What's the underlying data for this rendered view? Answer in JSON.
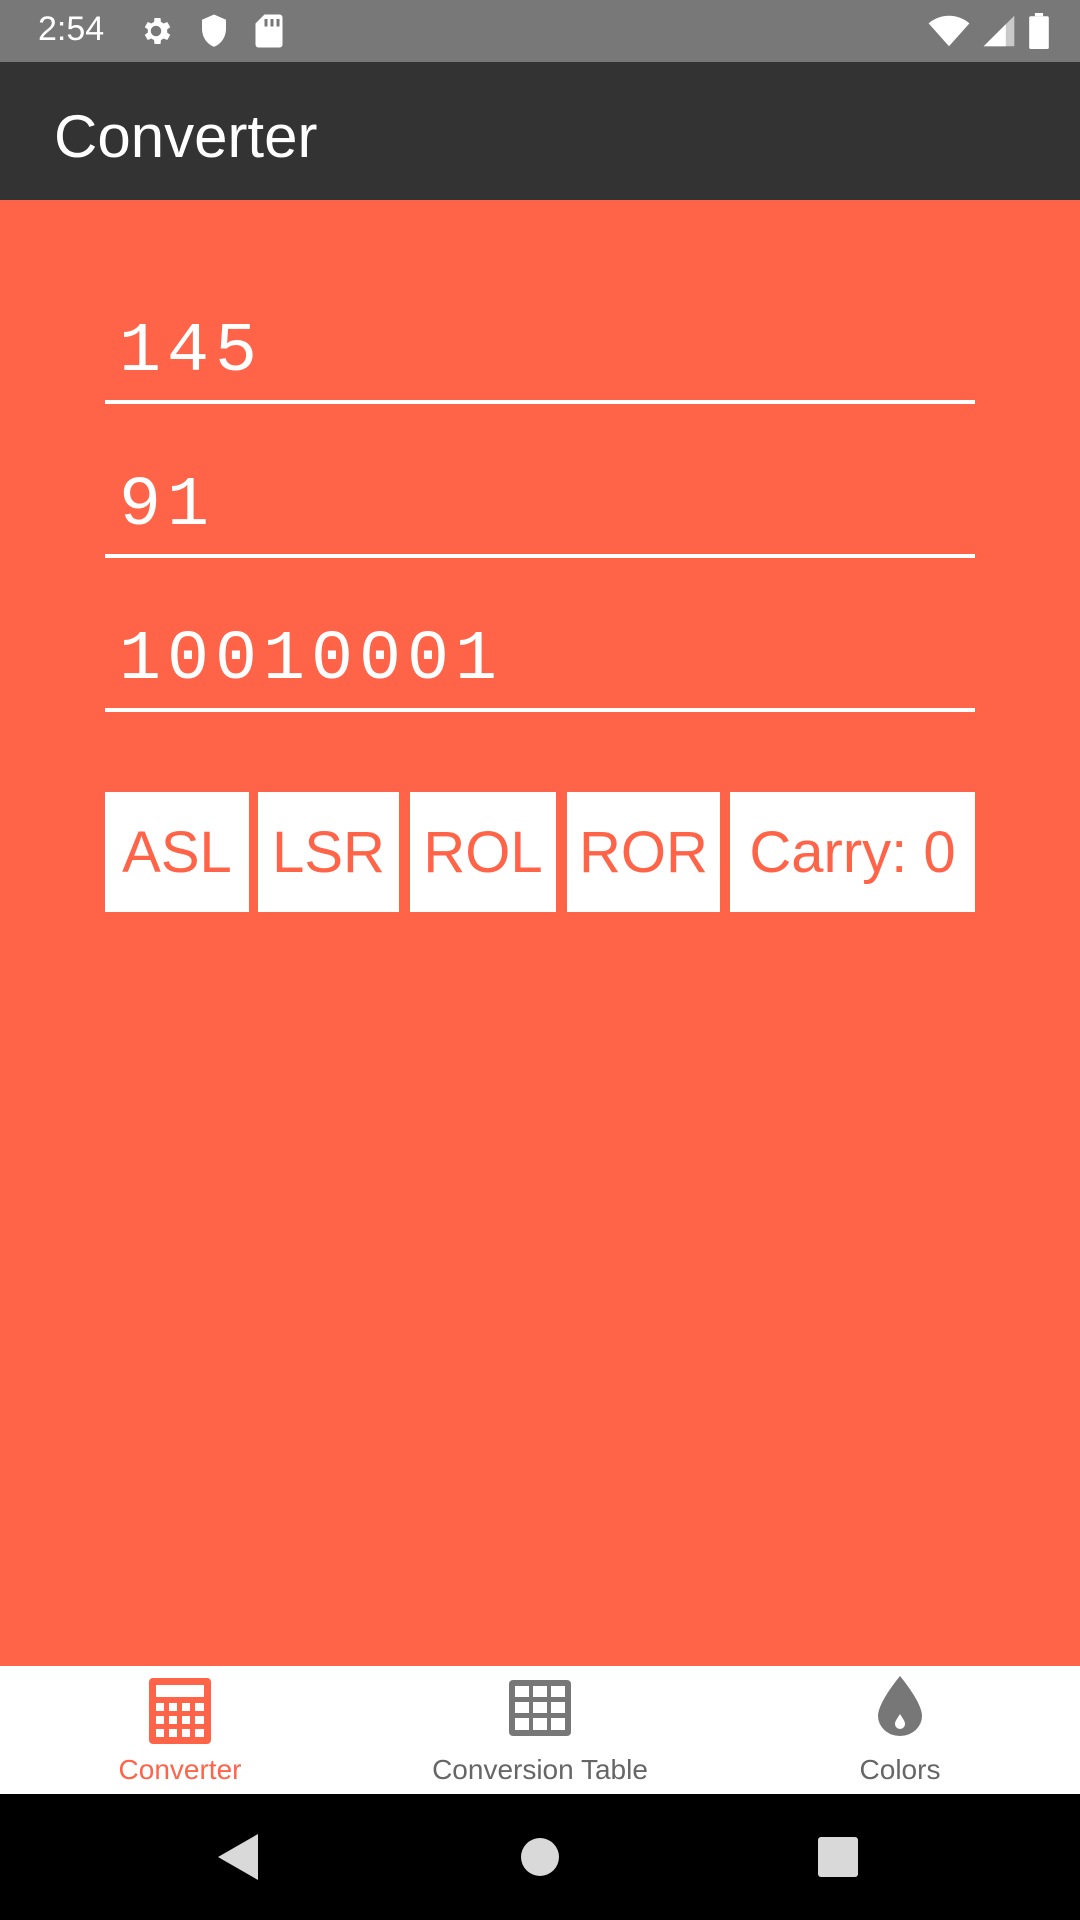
{
  "status_bar": {
    "time": "2:54",
    "icons_left": [
      "gear-icon",
      "shield-icon",
      "sd-card-icon"
    ],
    "icons_right": [
      "wifi-icon",
      "signal-icon",
      "battery-icon"
    ]
  },
  "app_bar": {
    "title": "Converter"
  },
  "fields": {
    "decimal": "145",
    "hex": "91",
    "binary": "10010001"
  },
  "buttons": {
    "asl": "ASL",
    "lsr": "LSR",
    "rol": "ROL",
    "ror": "ROR",
    "carry": "Carry: 0"
  },
  "bottom_nav": {
    "items": [
      {
        "label": "Converter",
        "icon": "calculator-icon",
        "active": true
      },
      {
        "label": "Conversion Table",
        "icon": "table-icon",
        "active": false
      },
      {
        "label": "Colors",
        "icon": "drop-icon",
        "active": false
      }
    ]
  },
  "colors": {
    "background": "#ff6448",
    "app_bar": "#333333",
    "status_bar": "#787878",
    "accent": "#ff6448",
    "inactive_nav": "#666666"
  }
}
